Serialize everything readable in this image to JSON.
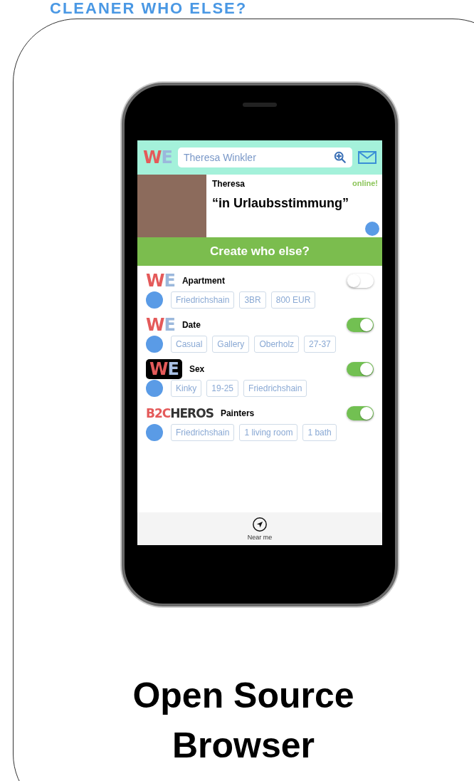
{
  "banner": {
    "title": "CLEANER WHO ELSE?"
  },
  "app": {
    "logo": {
      "kind": "we",
      "parts": [
        "W",
        "E"
      ]
    },
    "search": {
      "value": "Theresa Winkler"
    },
    "profile": {
      "name": "Theresa",
      "status": "online!",
      "quote": "“in Urlaubsstimmung”"
    },
    "create_banner": "Create who else?",
    "sections": [
      {
        "logo": {
          "kind": "we",
          "parts": [
            "W",
            "E"
          ]
        },
        "title": "Apartment",
        "on": false,
        "tags": [
          "Friedrichshain",
          "3BR",
          "800 EUR"
        ]
      },
      {
        "logo": {
          "kind": "we",
          "parts": [
            "W",
            "E"
          ]
        },
        "title": "Date",
        "on": true,
        "tags": [
          "Casual",
          "Gallery",
          "Oberholz",
          "27-37"
        ]
      },
      {
        "logo": {
          "kind": "we-dark",
          "parts": [
            "W",
            "E"
          ]
        },
        "title": "Sex",
        "on": true,
        "tags": [
          "Kinky",
          "19-25",
          "Friedrichshain"
        ]
      },
      {
        "logo": {
          "kind": "b2c",
          "parts": [
            "B2C",
            "HEROS"
          ]
        },
        "title": "Painters",
        "on": true,
        "tags": [
          "Friedrichshain",
          "1 living room",
          "1 bath"
        ]
      }
    ],
    "tab_bar": {
      "label": "Near me"
    }
  },
  "caption": [
    "Open Source",
    "Browser"
  ]
}
